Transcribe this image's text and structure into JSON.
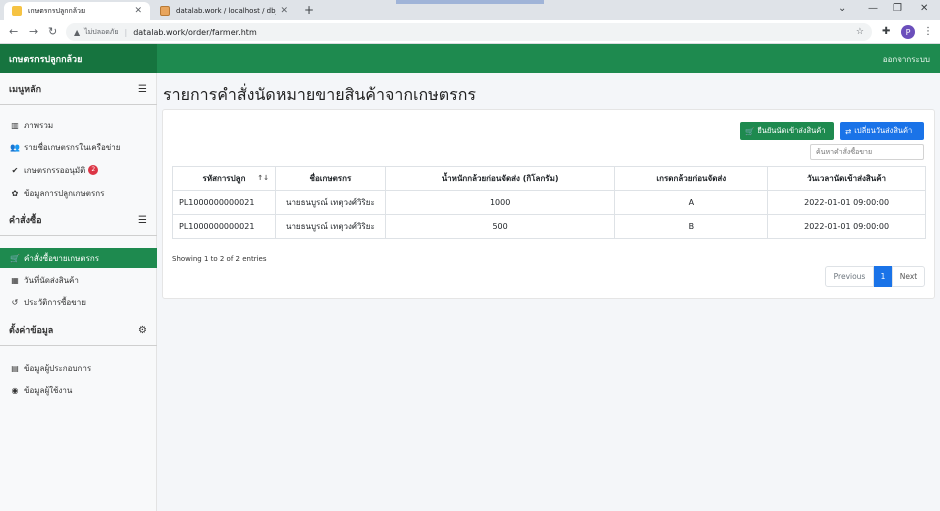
{
  "browser": {
    "tabs": [
      {
        "title": "เกษตรกรปลูกกล้วย",
        "close": "✕"
      },
      {
        "title": "datalab.work / localhost / db_ba",
        "close": "✕"
      }
    ],
    "new_tab": "+",
    "address": {
      "warning_icon": "warning-triangle-icon",
      "not_secure": "ไม่ปลอดภัย",
      "url": "datalab.work/order/farmer.htm"
    },
    "profile_initial": "P"
  },
  "header": {
    "brand": "เกษตรกรปลูกกล้วย",
    "logout": "ออกจากระบบ"
  },
  "sidebar": {
    "sections": [
      {
        "title": "เมนูหลัก",
        "icon": "bars-icon"
      },
      {
        "title": "คำสั่งซื้อ",
        "icon": "bars-icon"
      },
      {
        "title": "ตั้งค่าข้อมูล",
        "icon": "cogs-icon"
      }
    ],
    "main_items": [
      {
        "label": "ภาพรวม",
        "icon": "chart-icon"
      },
      {
        "label": "รายชื่อเกษตรกรในเครือข่าย",
        "icon": "users-icon"
      },
      {
        "label": "เกษตรกรรออนุมัติ",
        "icon": "check-circle-icon",
        "badge": "2"
      },
      {
        "label": "ข้อมูลการปลูกเกษตรกร",
        "icon": "seedling-icon"
      }
    ],
    "order_items": [
      {
        "label": "คำสั่งซื้อขายเกษตรกร",
        "icon": "cart-icon"
      },
      {
        "label": "วันที่นัดส่งสินค้า",
        "icon": "calendar-icon"
      },
      {
        "label": "ประวัติการซื้อขาย",
        "icon": "history-icon"
      }
    ],
    "setting_items": [
      {
        "label": "ข้อมูลผู้ประกอบการ",
        "icon": "building-icon"
      },
      {
        "label": "ข้อมูลผู้ใช้งาน",
        "icon": "user-circle-icon"
      }
    ]
  },
  "main": {
    "title": "รายการคำสั่งนัดหมายขายสินค้าจากเกษตรกร",
    "buttons": {
      "confirm": "ยืนยันนัดเข้าส่งสินค้า",
      "change": "เปลี่ยนวันส่งสินค้า"
    },
    "search_placeholder": "ค้นหาคำสั่งซื้อขาย",
    "table": {
      "headers": [
        "รหัสการปลูก",
        "ชื่อเกษตรกร",
        "น้ำหนักกล้วยก่อนจัดส่ง (กิโลกรัม)",
        "เกรดกล้วยก่อนจัดส่ง",
        "วันเวลานัดเข้าส่งสินค้า"
      ],
      "rows": [
        [
          "PL1000000000021",
          "นายธนบูรณ์ เทตุวงศ์วิริยะ",
          "1000",
          "A",
          "2022-01-01 09:00:00"
        ],
        [
          "PL1000000000021",
          "นายธนบูรณ์ เทตุวงศ์วิริยะ",
          "500",
          "B",
          "2022-01-01 09:00:00"
        ]
      ]
    },
    "info": "Showing 1 to 2 of 2 entries",
    "pagination": {
      "previous": "Previous",
      "current": "1",
      "next": "Next"
    }
  },
  "colors": {
    "primary_green": "#1e8a4f",
    "primary_blue": "#1a73e8",
    "badge_red": "#dc3545"
  }
}
